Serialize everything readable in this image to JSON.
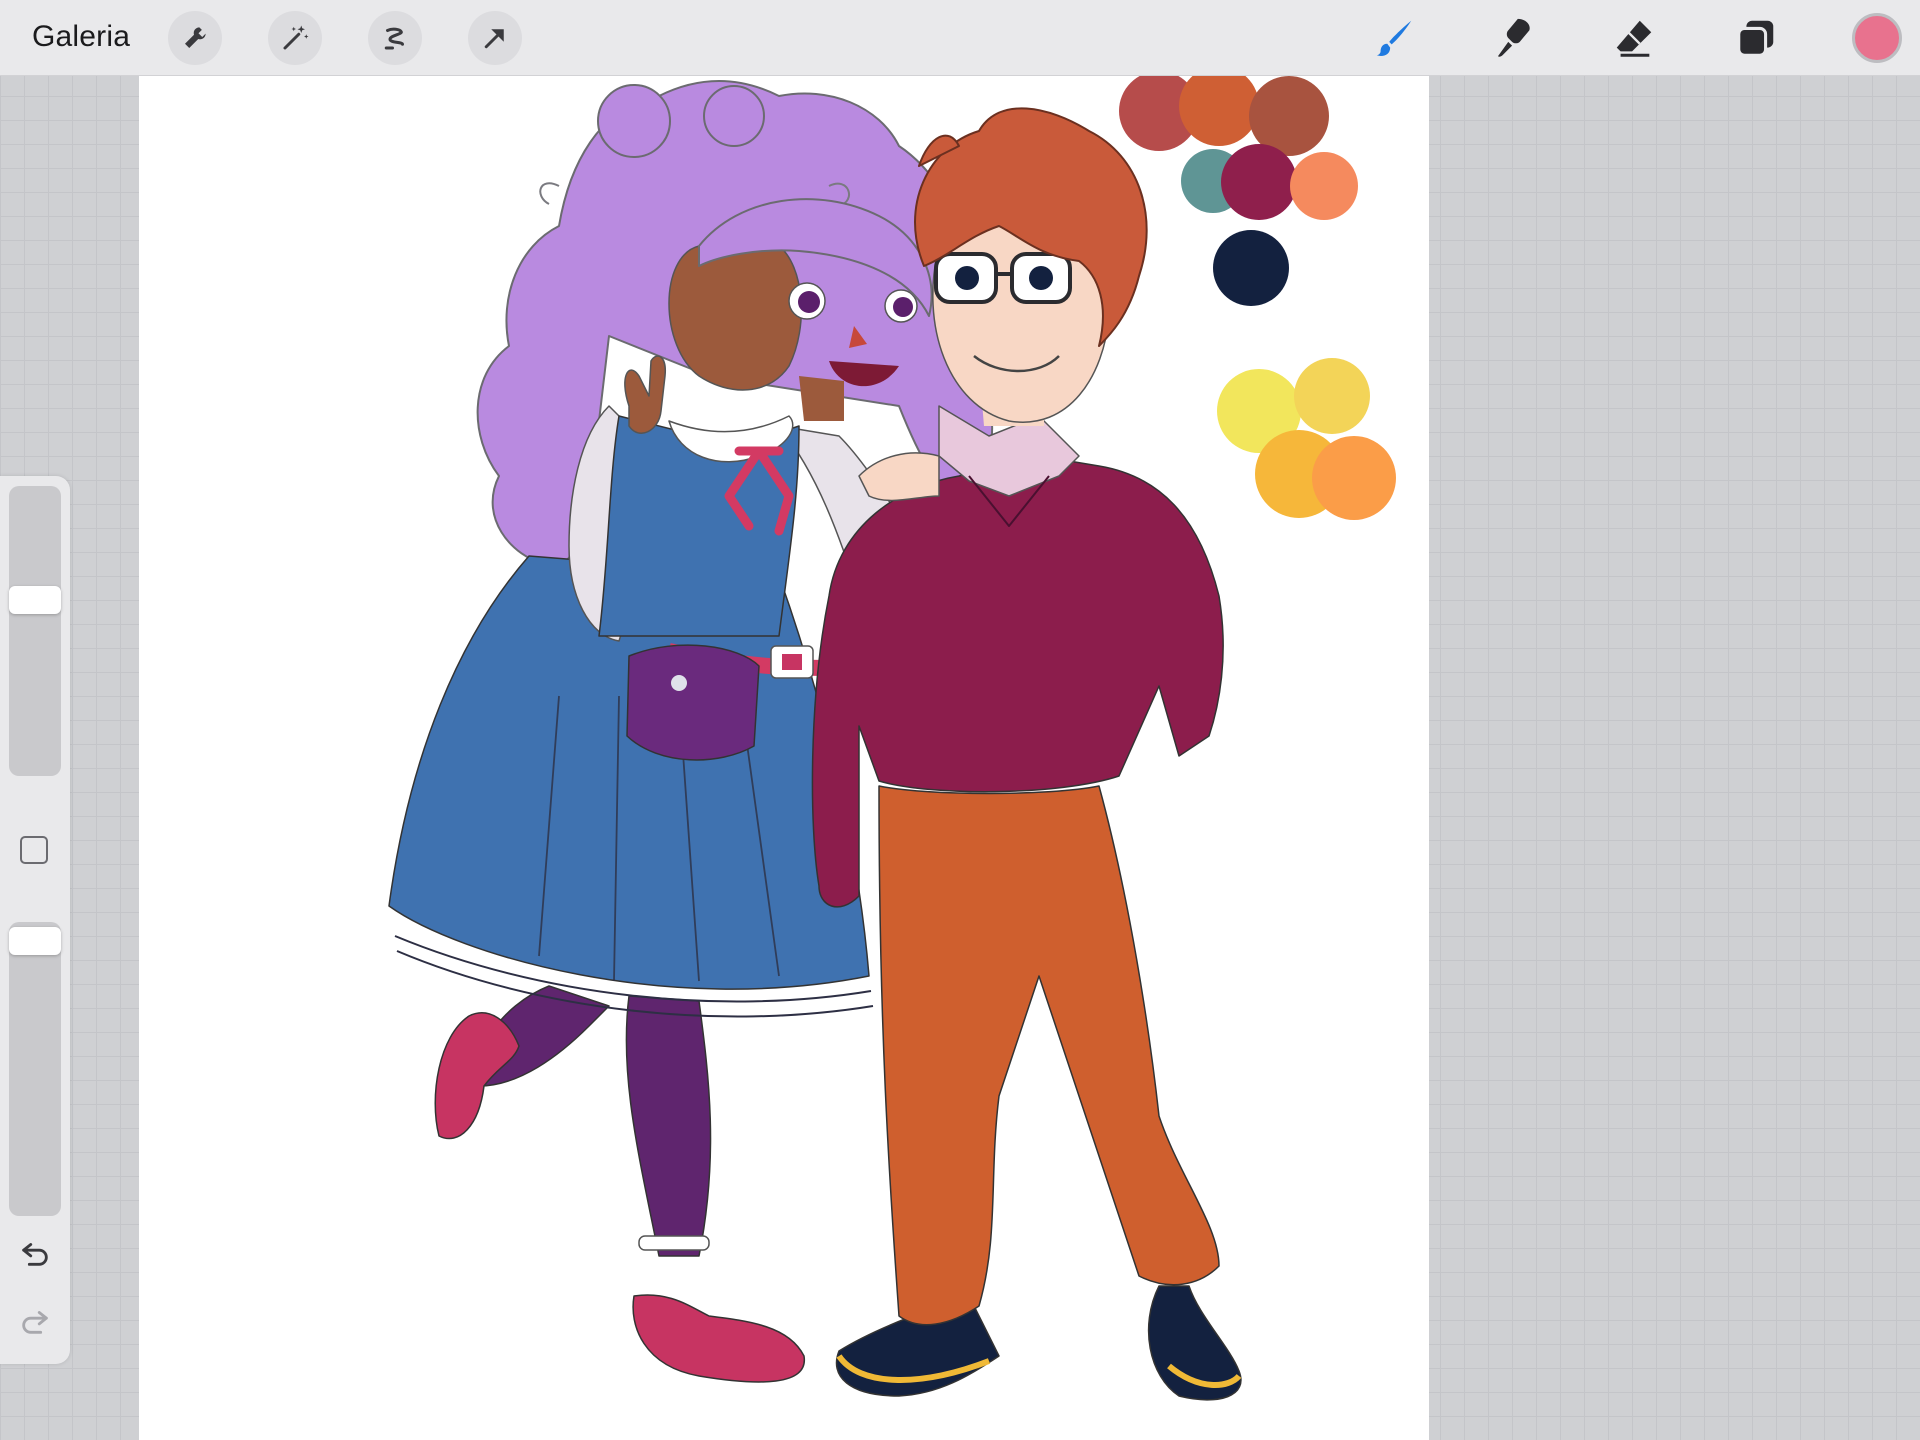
{
  "toolbar": {
    "gallery_label": "Galeria",
    "left_tools": [
      "wrench-icon",
      "magic-wand-icon",
      "selection-icon",
      "transform-arrow-icon"
    ],
    "right_tools": [
      "brush-icon",
      "smudge-icon",
      "eraser-icon",
      "layers-icon"
    ],
    "active_tool": "brush",
    "brush_active_color": "#1f7ae0",
    "current_color": "#e8728e"
  },
  "sidebar": {
    "brush_size_level": 0.38,
    "opacity_level": 0.02,
    "modify_button": "square-icon",
    "undo": "undo-icon",
    "redo": "redo-icon"
  },
  "palette_swatches": [
    "#b64c4b",
    "#cf5f34",
    "#a8533f",
    "#5f9595",
    "#8f1f4c",
    "#f58a5e",
    "#13213f",
    "#f2e65c",
    "#f3d458",
    "#f6b73a",
    "#fb9d48"
  ],
  "artwork": {
    "hair_purple": "#b98ae0",
    "dress_blue": "#3f72b0",
    "tights_purple": "#5f256e",
    "shoes_pink": "#c73462",
    "skin_dark": "#9c5a3c",
    "hair_red": "#c95a3a",
    "sweater": "#8c1d4c",
    "pants": "#cf5f2e",
    "skin_light": "#f8d7c5",
    "shirt": "#e8c8dc"
  }
}
